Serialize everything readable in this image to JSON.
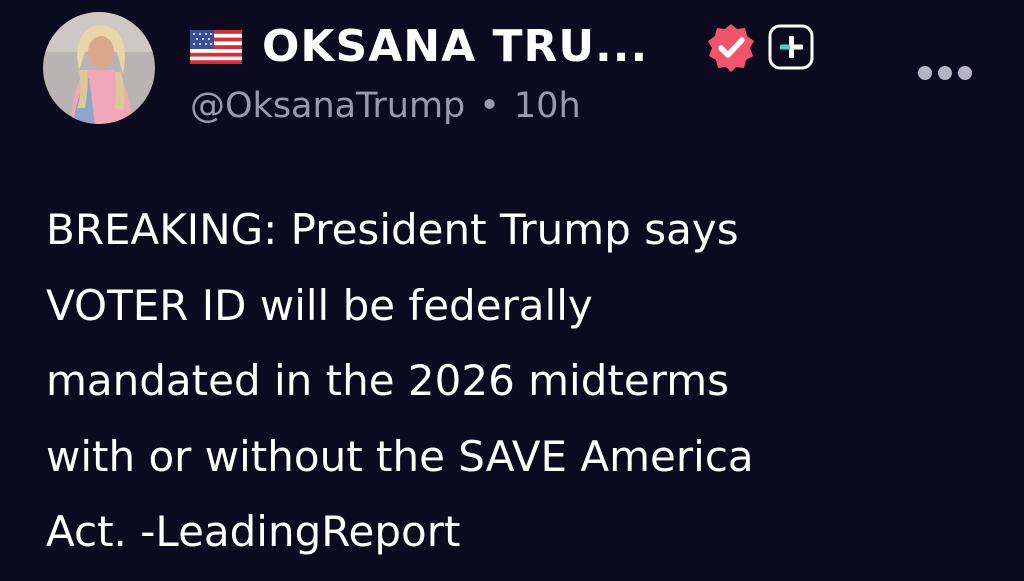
{
  "post": {
    "author": {
      "flag_icon": "us-flag-icon",
      "display_name": "OKSANA TRU...",
      "handle": "@OksanaTrump",
      "separator": "•",
      "time_ago": "10h",
      "verified_icon": "verified-badge-icon",
      "follow_icon": "plus-icon"
    },
    "more_icon": "more-options-icon",
    "text": "BREAKING: President Trump says\nVOTER ID will be federally\nmandated in the 2026 midterms\nwith or without the SAVE America\nAct. -LeadingReport"
  },
  "colors": {
    "background": "#0c0a1e",
    "text": "#ffffff",
    "secondary_text": "#9c98b0",
    "verified_badge": "#f0556b",
    "follow_accent": "#3fd9c3"
  }
}
